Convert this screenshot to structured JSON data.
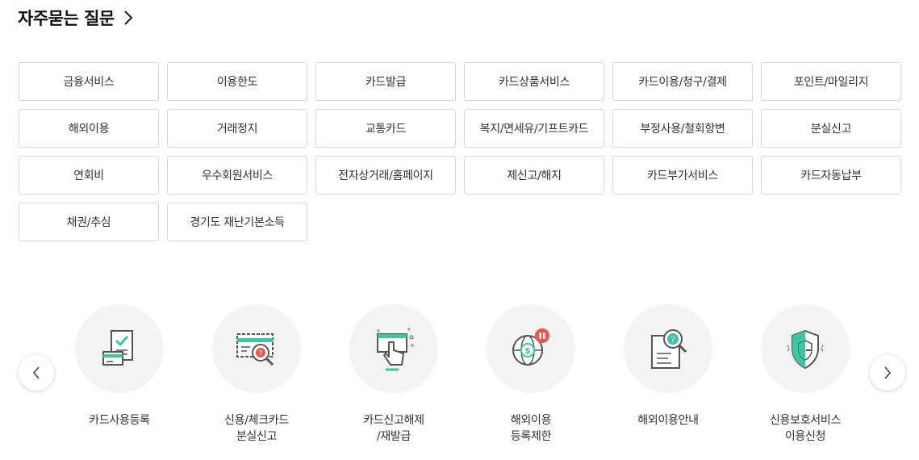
{
  "section": {
    "title": "자주묻는 질문"
  },
  "categories": [
    "금융서비스",
    "이용한도",
    "카드발급",
    "카드상품서비스",
    "카드이용/청구/결제",
    "포인트/마일리지",
    "해외이용",
    "거래정지",
    "교통카드",
    "복지/면세유/기프트카드",
    "부정사용/철회항변",
    "분실신고",
    "연회비",
    "우수회원서비스",
    "전자상거래/홈페이지",
    "제신고/해지",
    "카드부가서비스",
    "카드자동납부",
    "채권/추심",
    "경기도 재난기본소득"
  ],
  "services": [
    {
      "icon": "card-register-icon",
      "line1": "카드사용등록",
      "line2": ""
    },
    {
      "icon": "card-lost-report-icon",
      "line1": "신용/체크카드",
      "line2": "분실신고"
    },
    {
      "icon": "card-unblock-icon",
      "line1": "카드신고해제",
      "line2": "/재발급"
    },
    {
      "icon": "overseas-restrict-icon",
      "line1": "해외이용",
      "line2": "등록제한"
    },
    {
      "icon": "overseas-guide-icon",
      "line1": "해외이용안내",
      "line2": ""
    },
    {
      "icon": "credit-protect-icon",
      "line1": "신용보호서비스",
      "line2": "이용신청"
    }
  ],
  "colors": {
    "accent": "#3cc7a0",
    "icon_stroke": "#555555",
    "alert": "#e8584d"
  }
}
